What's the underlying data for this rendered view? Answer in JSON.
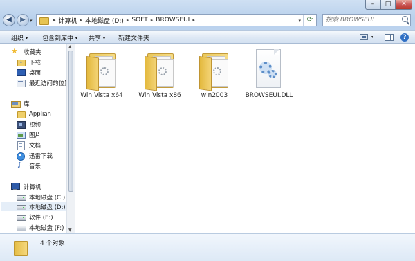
{
  "window": {
    "controls": {
      "minimize": "–",
      "maximize": "□",
      "close": "✕"
    }
  },
  "nav": {
    "back": "◀",
    "forward": "▶",
    "history_dropdown": "▾"
  },
  "address": {
    "crumbs": [
      "计算机",
      "本地磁盘 (D:)",
      "SOFT",
      "BROWSEUI"
    ],
    "separator": "▸",
    "dropdown": "▾",
    "refresh": "⟳"
  },
  "search": {
    "placeholder": "搜索 BROWSEUI"
  },
  "toolbar": {
    "organize": "组织",
    "include_in_library": "包含到库中",
    "share": "共享",
    "new_folder": "新建文件夹",
    "dropdown": "▾",
    "help": "?"
  },
  "navpane": {
    "favorites": "收藏夹",
    "downloads": "下载",
    "desktop": "桌面",
    "recent": "最近访问的位置",
    "libraries": "库",
    "applian": "Applian",
    "videos": "视频",
    "pictures": "图片",
    "documents": "文档",
    "thunder": "迅雷下载",
    "music": "音乐",
    "computer": "计算机",
    "drive_c": "本地磁盘 (C:)",
    "drive_d": "本地磁盘 (D:)",
    "drive_e": "软件 (E:)",
    "drive_f": "本地磁盘 (F:)",
    "scroll_up": "▲",
    "scroll_down": "▼"
  },
  "files": [
    {
      "name": "Win Vista x64",
      "type": "folder"
    },
    {
      "name": "Win Vista x86",
      "type": "folder"
    },
    {
      "name": "win2003",
      "type": "folder"
    },
    {
      "name": "BROWSEUI.DLL",
      "type": "dll"
    }
  ],
  "status": {
    "count": "4 个对象"
  }
}
